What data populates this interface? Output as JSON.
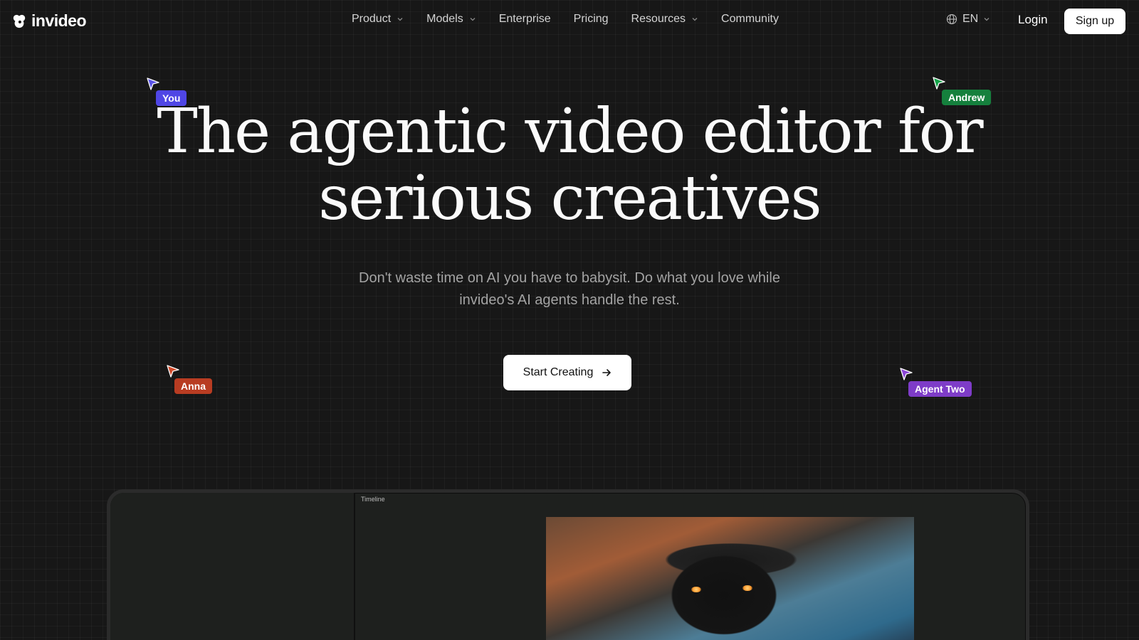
{
  "brand": {
    "name": "invideo"
  },
  "nav": {
    "links": [
      {
        "label": "Product",
        "dropdown": true
      },
      {
        "label": "Models",
        "dropdown": true
      },
      {
        "label": "Enterprise",
        "dropdown": false
      },
      {
        "label": "Pricing",
        "dropdown": false
      },
      {
        "label": "Resources",
        "dropdown": true
      },
      {
        "label": "Community",
        "dropdown": false
      }
    ],
    "language": "EN",
    "login_label": "Login",
    "signup_label": "Sign up"
  },
  "hero": {
    "title_line1": "The agentic video editor for",
    "title_line2": "serious creatives",
    "subtitle_line1": "Don't waste time on AI you have to babysit. Do what you love while",
    "subtitle_line2": "invideo's AI agents handle the rest.",
    "cta_label": "Start Creating"
  },
  "cursors": [
    {
      "name": "You",
      "color": "#4f46e5"
    },
    {
      "name": "Andrew",
      "color": "#15803d"
    },
    {
      "name": "Anna",
      "color": "#b83c22"
    },
    {
      "name": "Agent Two",
      "color": "#7e3cc8"
    }
  ],
  "editor": {
    "timeline_label": "Timeline"
  },
  "icons": [
    "logo-icon",
    "chevron-down-icon",
    "globe-icon",
    "arrow-right-icon",
    "cursor-arrow-icon"
  ]
}
